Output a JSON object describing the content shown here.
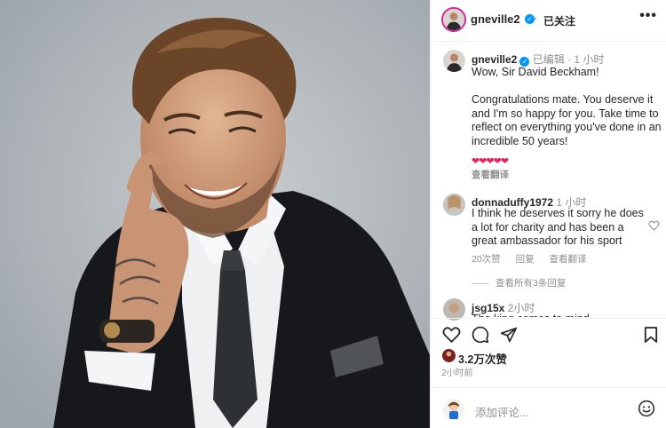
{
  "post": {
    "username": "gneville2",
    "follow_status": "已关注",
    "header_separator": "·",
    "more_label": "•••"
  },
  "caption": {
    "username": "gneville2",
    "edited": "已编辑",
    "time": "1 小时",
    "text": "Wow, Sir David Beckham!\n\nCongratulations mate. You deserve it and I'm so happy for you. Take time to reflect on everything you've done in an incredible 50 years!",
    "hearts": "❤❤❤❤❤",
    "see_translation": "查看翻译"
  },
  "comments": [
    {
      "username": "donnaduffy1972",
      "time": "1 小时",
      "text": "I think he deserves it sorry he does a lot for charity and has been a great ambassador for his sport",
      "likes": "20次赞",
      "reply": "回复",
      "translate": "查看翻译",
      "view_replies": "查看所有3条回复"
    },
    {
      "username": "jsg15x",
      "time": "2小时",
      "text": "The king comes to mind..."
    }
  ],
  "footer": {
    "likes": "3.2万次赞",
    "posted_time": "2小时前",
    "add_comment_placeholder": "添加评论..."
  },
  "colors": {
    "verified_blue": "#0095f6",
    "heart_red": "#e0245e",
    "muted": "#8e8e8e"
  }
}
